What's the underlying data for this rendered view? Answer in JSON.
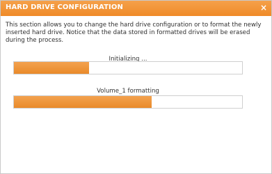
{
  "dialog": {
    "title": "HARD DRIVE CONFIGURATION",
    "close_glyph": "×",
    "close_icon": "close-icon",
    "description": "This section allows you to change the hard drive configuration or to format the newly inserted hard drive. Notice that the data stored in formatted drives will be erased during the process."
  },
  "tasks": [
    {
      "label": "Initializing ...",
      "progress": 0.33
    },
    {
      "label": "Volume_1 formatting",
      "progress": 0.605
    }
  ],
  "colors": {
    "accent": "#ef8a28",
    "progress_fill": "#ec8f31",
    "border": "#cfcfcf"
  }
}
